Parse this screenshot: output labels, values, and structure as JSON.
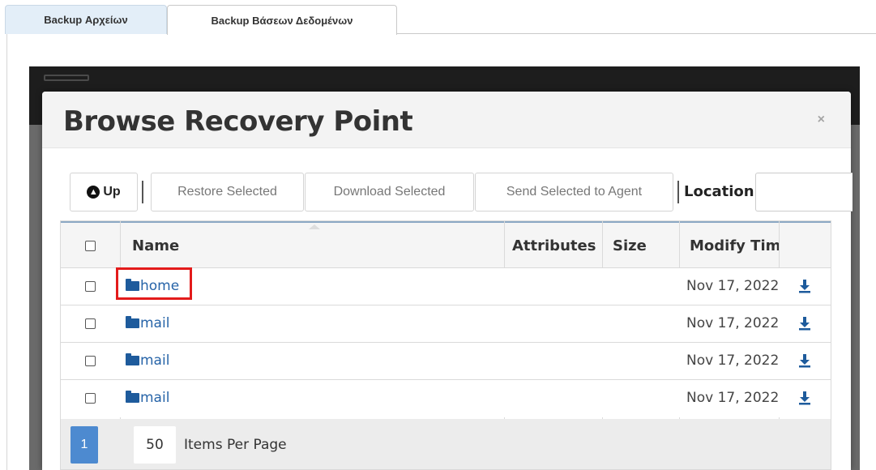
{
  "tabs": [
    {
      "label": "Backup Αρχείων",
      "active": true
    },
    {
      "label": "Backup Βάσεων Δεδομένων",
      "active": false
    }
  ],
  "modal": {
    "title": "Browse Recovery Point",
    "close": "×"
  },
  "toolbar": {
    "up_label": "Up",
    "up_icon": "arrow-up-circle-icon",
    "restore_label": "Restore Selected",
    "download_label": "Download Selected",
    "send_label": "Send Selected to Agent",
    "location_label": "Location",
    "location_value": ""
  },
  "table": {
    "columns": [
      "Name",
      "Attributes",
      "Size",
      "Modify Tim"
    ],
    "rows": [
      {
        "name": "home",
        "attributes": "",
        "size": "",
        "modified": "Nov 17, 2022",
        "highlighted": true
      },
      {
        "name": "mail",
        "attributes": "",
        "size": "",
        "modified": "Nov 17, 2022",
        "highlighted": false
      },
      {
        "name": "mail",
        "attributes": "",
        "size": "",
        "modified": "Nov 17, 2022",
        "highlighted": false
      },
      {
        "name": "mail",
        "attributes": "",
        "size": "",
        "modified": "Nov 17, 2022",
        "highlighted": false
      }
    ]
  },
  "pager": {
    "current_page": "1",
    "per_page": "50",
    "per_page_label": "Items Per Page"
  },
  "colors": {
    "accent": "#4d8ad0",
    "link": "#2764a8",
    "highlight": "#e31b1b",
    "active_tab": "#e3eef8"
  }
}
